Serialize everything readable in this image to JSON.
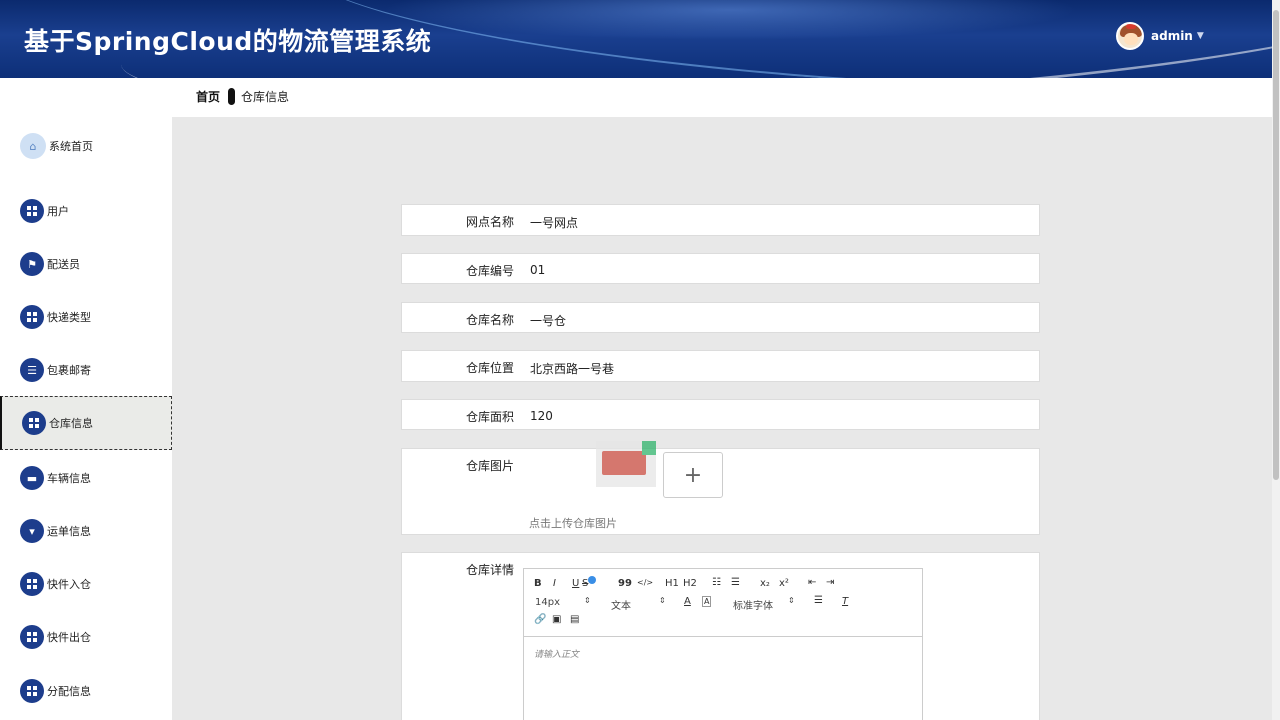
{
  "header": {
    "app_title": "基于SpringCloud的物流管理系统",
    "username": "admin",
    "caret_icon": "caret-down-icon"
  },
  "breadcrumb": {
    "home": "首页",
    "current": "仓库信息"
  },
  "sidebar": {
    "items": [
      {
        "label": "系统首页",
        "icon": "home-icon"
      },
      {
        "label": "用户",
        "icon": "grid-icon"
      },
      {
        "label": "配送员",
        "icon": "flag-icon"
      },
      {
        "label": "快递类型",
        "icon": "grid-icon"
      },
      {
        "label": "包裹邮寄",
        "icon": "list-icon"
      },
      {
        "label": "仓库信息",
        "icon": "grid-icon",
        "active": true
      },
      {
        "label": "车辆信息",
        "icon": "monitor-icon"
      },
      {
        "label": "运单信息",
        "icon": "pin-icon"
      },
      {
        "label": "快件入仓",
        "icon": "grid-icon"
      },
      {
        "label": "快件出仓",
        "icon": "grid-icon"
      },
      {
        "label": "分配信息",
        "icon": "grid-icon"
      }
    ]
  },
  "form": {
    "branch_name_label": "网点名称",
    "branch_name_value": "一号网点",
    "warehouse_code_label": "仓库编号",
    "warehouse_code_value": "01",
    "warehouse_name_label": "仓库名称",
    "warehouse_name_value": "一号仓",
    "warehouse_location_label": "仓库位置",
    "warehouse_location_value": "北京西路一号巷",
    "warehouse_area_label": "仓库面积",
    "warehouse_area_value": "120",
    "warehouse_image_label": "仓库图片",
    "upload_plus": "+",
    "upload_hint": "点击上传仓库图片",
    "warehouse_detail_label": "仓库详情"
  },
  "editor": {
    "bold": "B",
    "italic": "I",
    "underline": "U",
    "strike": "S",
    "quote": "99",
    "code": "</>",
    "h1": "H1",
    "h2": "H2",
    "subscript": "x₂",
    "superscript": "x²",
    "font_size": "14px",
    "block_type": "文本",
    "font_family": "标准字体",
    "placeholder": "请输入正文"
  }
}
